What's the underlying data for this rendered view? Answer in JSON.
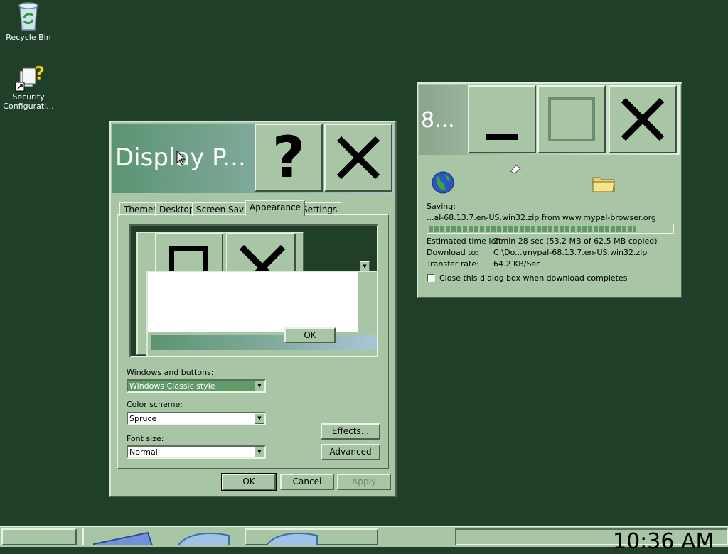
{
  "desktop": {
    "icons": [
      {
        "label": "Recycle Bin",
        "icon": "recycle-bin-icon"
      },
      {
        "label": "Security Configurati...",
        "icon": "security-config-icon"
      }
    ]
  },
  "display_window": {
    "title": "Display P...",
    "help_glyph": "?",
    "tabs": [
      "Themes",
      "Desktop",
      "Screen Saver",
      "Appearance",
      "Settings"
    ],
    "active_tab": "Appearance",
    "preview": {
      "message_button": "OK"
    },
    "windows_and_buttons_label": "Windows and buttons:",
    "windows_and_buttons_value": "Windows Classic style",
    "color_scheme_label": "Color scheme:",
    "color_scheme_value": "Spruce",
    "font_size_label": "Font size:",
    "font_size_value": "Normal",
    "effects_button": "Effects...",
    "advanced_button": "Advanced",
    "ok_button": "OK",
    "cancel_button": "Cancel",
    "apply_button": "Apply"
  },
  "download_window": {
    "title": "8...",
    "saving_label": "Saving:",
    "saving_value": "...al-68.13.7.en-US.win32.zip from www.mypal-browser.org",
    "progress": 0.85,
    "time_left_label": "Estimated time left",
    "time_left_value": "2 min 28 sec (53.2 MB of 62.5 MB copied)",
    "download_to_label": "Download to:",
    "download_to_value": "C:\\Do...\\mypal-68.13.7.en-US.win32.zip",
    "transfer_rate_label": "Transfer rate:",
    "transfer_rate_value": "64.2 KB/Sec",
    "close_checkbox_label": "Close this dialog box when download completes",
    "close_checkbox_checked": false
  },
  "taskbar": {
    "clock": "10:36 AM"
  },
  "colors": {
    "desktop": "#1f3f28",
    "face": "#a8c6a6",
    "progress": "#5f9a67"
  }
}
